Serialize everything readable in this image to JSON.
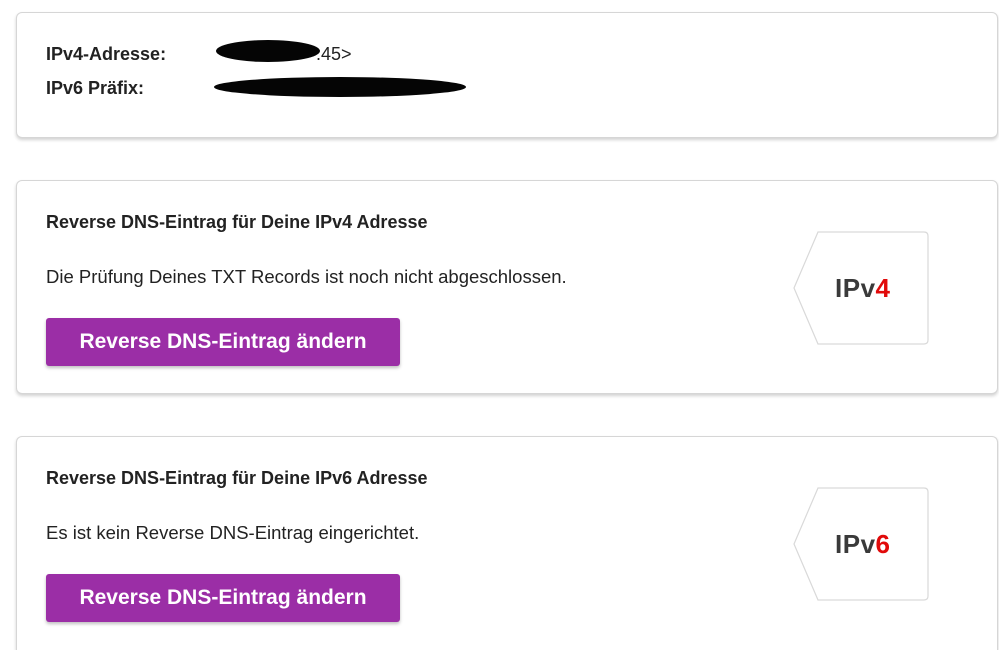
{
  "address_card": {
    "ipv4_label": "IPv4-Adresse:",
    "ipv4_value_visible": ".45>",
    "ipv6_label": "IPv6 Präfix:"
  },
  "ipv4_section": {
    "title": "Reverse DNS-Eintrag für Deine IPv4 Adresse",
    "status": "Die Prüfung Deines TXT Records ist noch nicht abgeschlossen.",
    "button_label": "Reverse DNS-Eintrag ändern",
    "badge_prefix": "IPv",
    "badge_number": "4"
  },
  "ipv6_section": {
    "title": "Reverse DNS-Eintrag für Deine IPv6 Adresse",
    "status": "Es ist kein Reverse DNS-Eintrag eingerichtet.",
    "button_label": "Reverse DNS-Eintrag ändern",
    "badge_prefix": "IPv",
    "badge_number": "6"
  },
  "colors": {
    "button_bg": "#9b2ea6",
    "badge_accent": "#e10a0a"
  }
}
